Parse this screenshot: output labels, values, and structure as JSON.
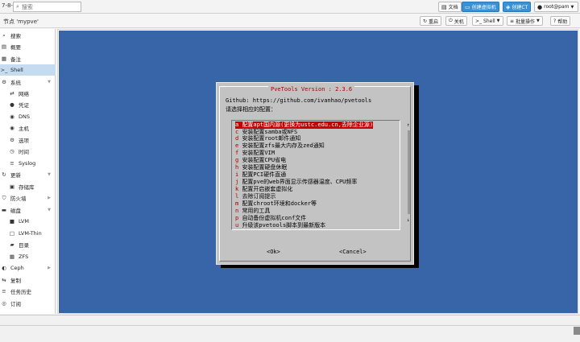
{
  "topbar": {
    "version": "7-8-3",
    "search_placeholder": "搜索",
    "docs_label": "文档",
    "create_vm_label": "创建虚拟机",
    "create_ct_label": "创建CT",
    "user_label": "root@pam"
  },
  "node_header": {
    "title": "节点 'mypve'",
    "restart_label": "重启",
    "shutdown_label": "关机",
    "shell_label": "Shell",
    "bulk_label": "批量操作",
    "help_label": "帮助"
  },
  "sidebar": {
    "items": [
      {
        "label": "搜索",
        "icon": "search-icon"
      },
      {
        "label": "概要",
        "icon": "book-icon"
      },
      {
        "label": "备注",
        "icon": "notes-icon"
      },
      {
        "label": "Shell",
        "icon": "terminal-icon",
        "active": true
      },
      {
        "label": "系统",
        "icon": "gear-icon",
        "expandable": true
      },
      {
        "label": "网络",
        "icon": "network-icon"
      },
      {
        "label": "凭证",
        "icon": "certificate-icon"
      },
      {
        "label": "DNS",
        "icon": "globe-icon"
      },
      {
        "label": "主机",
        "icon": "globe-icon"
      },
      {
        "label": "选项",
        "icon": "gear-icon"
      },
      {
        "label": "时间",
        "icon": "clock-icon"
      },
      {
        "label": "Syslog",
        "icon": "list-icon"
      },
      {
        "label": "更新",
        "icon": "refresh-icon",
        "expandable": true
      },
      {
        "label": "存储库",
        "icon": "archive-icon"
      },
      {
        "label": "防火墙",
        "icon": "shield-icon",
        "expandable": true
      },
      {
        "label": "磁盘",
        "icon": "disk-icon",
        "expandable": true
      },
      {
        "label": "LVM",
        "icon": "square-icon"
      },
      {
        "label": "LVM-Thin",
        "icon": "square-outline-icon"
      },
      {
        "label": "目录",
        "icon": "folder-icon"
      },
      {
        "label": "ZFS",
        "icon": "grid-icon"
      },
      {
        "label": "Ceph",
        "icon": "ceph-icon",
        "expandable": true
      },
      {
        "label": "复制",
        "icon": "retweet-icon"
      },
      {
        "label": "任务历史",
        "icon": "list-icon"
      },
      {
        "label": "订阅",
        "icon": "support-icon"
      }
    ]
  },
  "terminal": {
    "dialog_title": "PveTools  Version : 2.3.6",
    "github_line": "Github: https://github.com/ivanhao/pvetools",
    "prompt_line": "请选择相应的配置：",
    "menu": [
      {
        "key": "a",
        "label": "配置apt国内源(更换为ustc.edu.cn,去除企业源)",
        "selected": true
      },
      {
        "key": "c",
        "label": "安装配置samba或NFS"
      },
      {
        "key": "d",
        "label": "安装配置root邮件通知"
      },
      {
        "key": "e",
        "label": "安装配置zfs最大内存及zed通知"
      },
      {
        "key": "f",
        "label": "安装配置VIM"
      },
      {
        "key": "g",
        "label": "安装配置CPU省电"
      },
      {
        "key": "h",
        "label": "安装配置硬盘休眠"
      },
      {
        "key": "i",
        "label": "配置PCI硬件直通"
      },
      {
        "key": "j",
        "label": "配置pve的web界面显示传感器温度、CPU频率"
      },
      {
        "key": "k",
        "label": "配置开启嵌套虚拟化"
      },
      {
        "key": "l",
        "label": "去除订阅提示"
      },
      {
        "key": "m",
        "label": "配置chroot环境和docker等"
      },
      {
        "key": "n",
        "label": "常用的工具"
      },
      {
        "key": "p",
        "label": "自动备份虚拟机conf文件"
      },
      {
        "key": "u",
        "label": "升级该pvetools脚本到最新版本"
      }
    ],
    "ok_label": "<Ok>",
    "cancel_label": "<Cancel>",
    "scroll_up": "↑",
    "scroll_down": "↓"
  },
  "colors": {
    "terminal_bg": "#3864a8",
    "dialog_bg": "#c3c3c3",
    "selection": "#c60000",
    "accent_button": "#3892d4",
    "sidebar_active": "#c5dcf0"
  }
}
